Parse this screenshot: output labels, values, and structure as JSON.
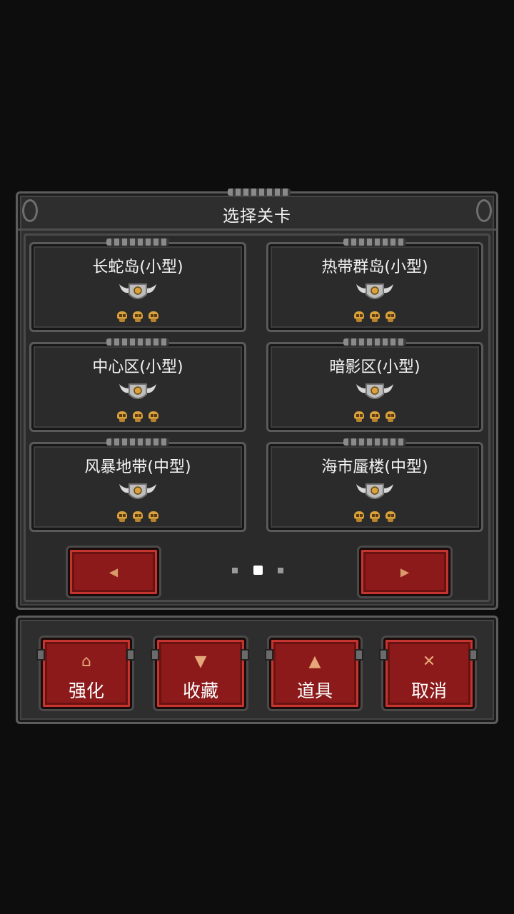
{
  "dialog": {
    "title": "选择关卡"
  },
  "levels": [
    {
      "name": "长蛇岛(小型)",
      "skulls": 3
    },
    {
      "name": "热带群岛(小型)",
      "skulls": 3
    },
    {
      "name": "中心区(小型)",
      "skulls": 3
    },
    {
      "name": "暗影区(小型)",
      "skulls": 3
    },
    {
      "name": "风暴地带(中型)",
      "skulls": 3
    },
    {
      "name": "海市蜃楼(中型)",
      "skulls": 3
    }
  ],
  "pager": {
    "prev_icon": "◀",
    "next_icon": "▶",
    "page_count": 3,
    "current_page": 2
  },
  "actions": [
    {
      "label": "强化",
      "icon": "⌂",
      "icon_name": "upgrade-icon"
    },
    {
      "label": "收藏",
      "icon": "▼",
      "icon_name": "goblet-icon"
    },
    {
      "label": "道具",
      "icon": "▲",
      "icon_name": "potion-icon"
    },
    {
      "label": "取消",
      "icon": "✕",
      "icon_name": "close-icon"
    }
  ],
  "colors": {
    "button_red": "#8c1a1a",
    "skull_gold": "#d9a23c",
    "panel_gray": "#2e2e2e"
  }
}
